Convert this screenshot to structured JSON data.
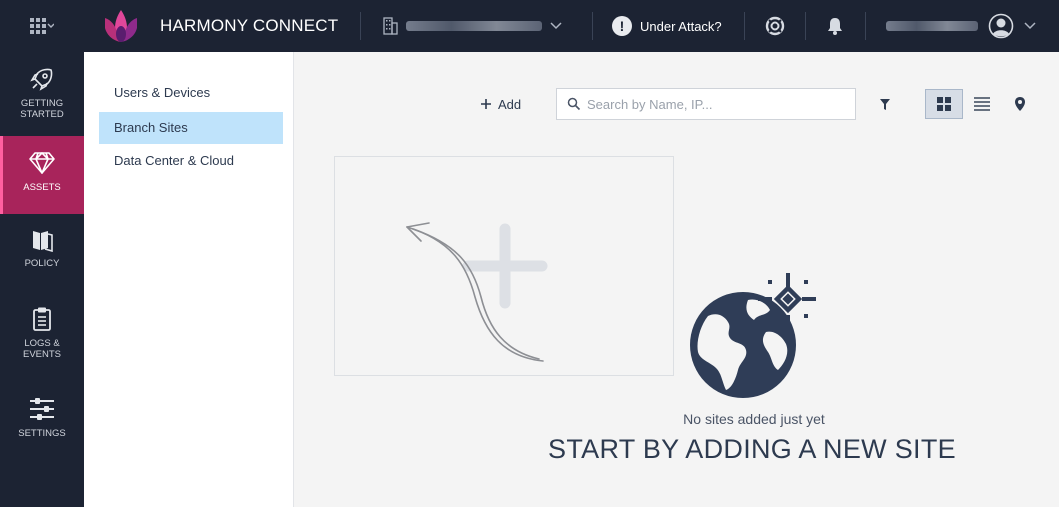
{
  "app": {
    "brand": "HARMONY CONNECT"
  },
  "topbar": {
    "under_attack_label": "Under Attack?"
  },
  "rail": {
    "items": [
      {
        "label_line1": "GETTING",
        "label_line2": "STARTED",
        "icon": "rocket-icon"
      },
      {
        "label_line1": "ASSETS",
        "label_line2": "",
        "icon": "diamond-icon"
      },
      {
        "label_line1": "POLICY",
        "label_line2": "",
        "icon": "policy-book-icon"
      },
      {
        "label_line1": "LOGS &",
        "label_line2": "EVENTS",
        "icon": "clipboard-icon"
      },
      {
        "label_line1": "SETTINGS",
        "label_line2": "",
        "icon": "sliders-icon"
      }
    ],
    "active": "ASSETS"
  },
  "subnav": {
    "items": [
      {
        "label": "Users & Devices"
      },
      {
        "label": "Branch Sites"
      },
      {
        "label": "Data Center & Cloud"
      }
    ],
    "active": "Branch Sites"
  },
  "toolbar": {
    "add_label": "Add",
    "search_placeholder": "Search by Name, IP...",
    "search_value": ""
  },
  "empty_state": {
    "message": "No sites added just yet",
    "title": "START BY ADDING A NEW SITE"
  },
  "colors": {
    "topbar_bg": "#1c2333",
    "active_nav": "#a8245b",
    "active_subnav": "#bfe3fb",
    "accent_dark": "#2d3a4f"
  }
}
